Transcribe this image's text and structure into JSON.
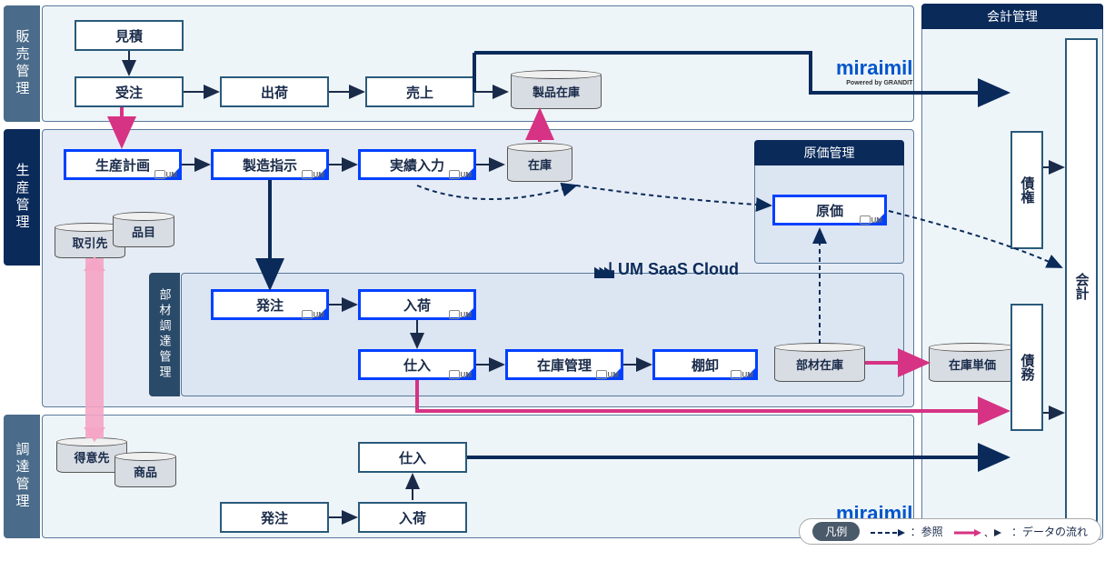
{
  "sections": {
    "sales": "販売管理",
    "production": "生産管理",
    "material": "部材調達管理",
    "procurement": "調達管理",
    "accounting": "会計管理",
    "cost": "原価管理"
  },
  "boxes": {
    "quote": "見積",
    "order": "受注",
    "ship": "出荷",
    "sales": "売上",
    "product_stock": "製品在庫",
    "prod_plan": "生産計画",
    "mfg_order": "製造指示",
    "result_entry": "実績入力",
    "stock": "在庫",
    "partner": "取引先",
    "item": "品目",
    "po1": "発注",
    "receipt1": "入荷",
    "purchase1": "仕入",
    "inv_mgmt": "在庫管理",
    "stocktake": "棚卸",
    "mat_stock": "部材在庫",
    "cost": "原価",
    "customer": "得意先",
    "goods": "商品",
    "purchase2": "仕入",
    "po2": "発注",
    "receipt2": "入荷",
    "stock_price": "在庫単価",
    "receivable": "債権",
    "payable": "債務",
    "accounting": "会計"
  },
  "logos": {
    "miraimil": "miraimil",
    "miraimil_sub": "Powered by GRANDIT",
    "umsaas": "UM SaaS Cloud",
    "um_tag": "UM"
  },
  "legend": {
    "title": "凡例",
    "reference": "：参照",
    "dataflow": "：データの流れ"
  }
}
